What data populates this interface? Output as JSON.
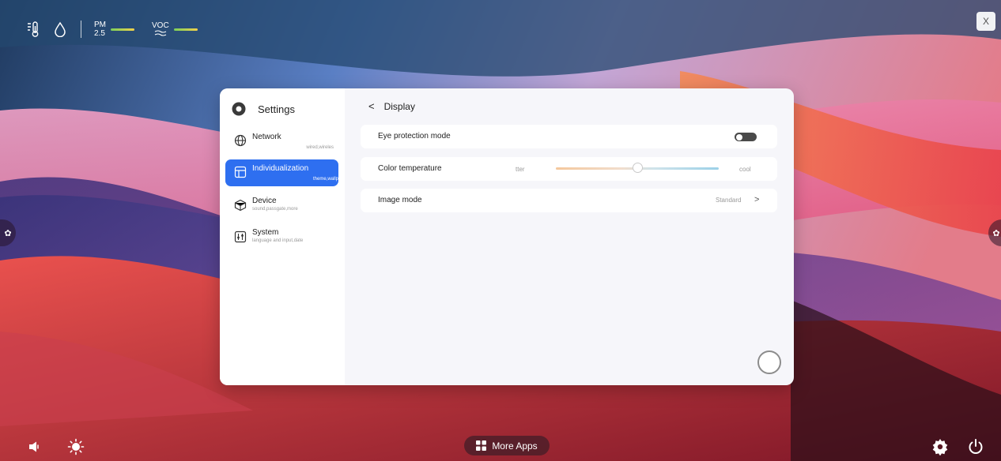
{
  "colors": {
    "accent": "#2e6ff0",
    "toggle_off": "#4a4a4a",
    "slider_warm": "#f4c79c",
    "slider_cool": "#9cd1e8",
    "air_quality_good": "#7bd05b"
  },
  "status_bar": {
    "icons": [
      "thermometer-icon",
      "humidity-drop-icon"
    ],
    "pm": {
      "label_top": "PM",
      "label_bottom": "2.5"
    },
    "voc": {
      "label": "VOC"
    }
  },
  "window_close": {
    "label": "X"
  },
  "settings": {
    "title": "Settings",
    "sidebar": [
      {
        "label": "Network",
        "sub": "wired,wireles",
        "icon": "globe-icon",
        "active": false
      },
      {
        "label": "Individualization",
        "sub": "theme,wallp",
        "icon": "layout-icon",
        "active": true
      },
      {
        "label": "Device",
        "sub": "sound,passgate,more",
        "icon": "cube-icon",
        "active": false
      },
      {
        "label": "System",
        "sub": "language and input,date",
        "icon": "sliders-icon",
        "active": false
      }
    ],
    "page": {
      "back_icon": "<",
      "title": "Display",
      "eye_protection": {
        "label": "Eye protection mode",
        "enabled": false
      },
      "color_temperature": {
        "label": "Color temperature",
        "low_label": "tter",
        "high_label": "cool",
        "value": 0.5
      },
      "image_mode": {
        "label": "Image mode",
        "value": "Standard",
        "chevron": ">"
      }
    }
  },
  "dock": {
    "left": [
      "volume-icon",
      "brightness-icon"
    ],
    "center": {
      "label": "More Apps",
      "icon": "grid-icon"
    },
    "right": [
      "settings-gear-icon",
      "power-icon"
    ]
  }
}
